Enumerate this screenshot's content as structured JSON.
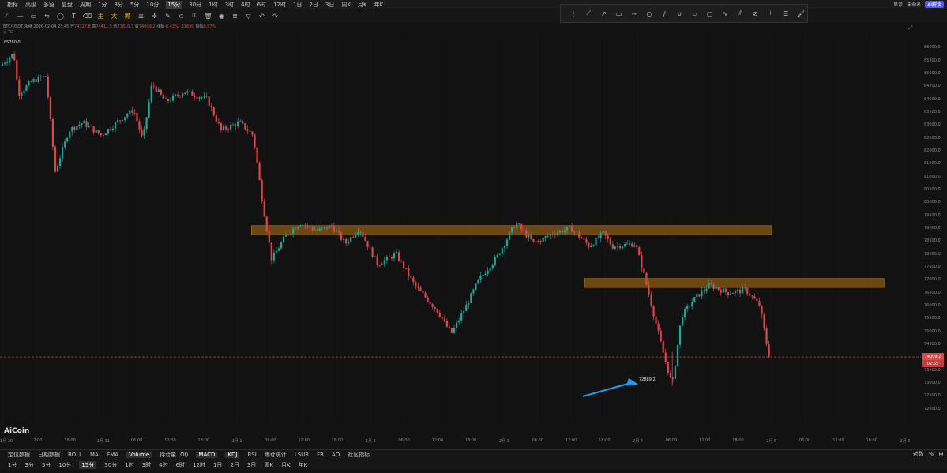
{
  "topbar": {
    "items": [
      {
        "label": "指标",
        "selected": false
      },
      {
        "label": "高级",
        "selected": false
      },
      {
        "label": "多窗",
        "selected": false
      },
      {
        "label": "复盘",
        "selected": false
      },
      {
        "label": "周期",
        "selected": false
      },
      {
        "label": "1分",
        "selected": false
      },
      {
        "label": "3分",
        "selected": false
      },
      {
        "label": "5分",
        "selected": false
      },
      {
        "label": "10分",
        "selected": false
      },
      {
        "label": "15分",
        "selected": true
      },
      {
        "label": "30分",
        "selected": false
      },
      {
        "label": "1时",
        "selected": false
      },
      {
        "label": "3时",
        "selected": false
      },
      {
        "label": "4时",
        "selected": false
      },
      {
        "label": "6时",
        "selected": false
      },
      {
        "label": "12时",
        "selected": false
      },
      {
        "label": "1日",
        "selected": false
      },
      {
        "label": "2日",
        "selected": false
      },
      {
        "label": "3日",
        "selected": false
      },
      {
        "label": "周K",
        "selected": false
      },
      {
        "label": "月K",
        "selected": false
      },
      {
        "label": "年K",
        "selected": false
      }
    ],
    "right_display": "显示",
    "right_layout": "未命名",
    "ai_button": "AI解读"
  },
  "toolbar": {
    "gold_labels": [
      "主",
      "大",
      "筹"
    ]
  },
  "ohlc": {
    "symbol": "BTC/USDT·永续",
    "time": "2026-02-04 23:45",
    "open_label": "开",
    "open": "74327.8",
    "high_label": "高",
    "high": "74411.5",
    "low_label": "低",
    "low": "73810.7",
    "close_label": "收",
    "close": "74009.2",
    "change_label": "涨幅",
    "change": "-0.43%(-318.6)",
    "amp_label": "振幅",
    "amp": "0.87%"
  },
  "sub_label": "TD",
  "hi_label": "85780.0",
  "low_marker": "72889.2",
  "watermark": "AiCoin",
  "price_tag": "74009.2",
  "time_tag": "02:55",
  "colors": {
    "up": "#1aa89a",
    "down": "#e0454a",
    "zone": "#8a5a14",
    "arrow": "#1e9bf0",
    "background": "#121212"
  },
  "chart_data": {
    "type": "candlestick",
    "symbol": "BTC/USDT",
    "interval": "15分",
    "ylim": [
      71500,
      86500
    ],
    "y_ticks": [
      72000,
      72500,
      73000,
      73500,
      74000,
      74500,
      75000,
      75500,
      76000,
      76500,
      77000,
      77500,
      78000,
      78500,
      79000,
      79500,
      80000,
      80500,
      81000,
      81500,
      82000,
      82500,
      83000,
      83500,
      84000,
      84500,
      85000,
      85500,
      86000
    ],
    "x_ticks": [
      "1月 30",
      "12:00",
      "18:00",
      "1月 31",
      "06:00",
      "12:00",
      "18:00",
      "2月 1",
      "06:00",
      "12:00",
      "18:00",
      "2月 2",
      "06:00",
      "12:00",
      "18:00",
      "2月 3",
      "06:00",
      "12:00",
      "18:00",
      "2月 4",
      "06:00",
      "12:00",
      "18:00",
      "2月 5",
      "06:00",
      "12:00",
      "18:00",
      "2月 6"
    ],
    "price_path": [
      [
        0,
        85300
      ],
      [
        0.015,
        85780
      ],
      [
        0.02,
        84200
      ],
      [
        0.035,
        84700
      ],
      [
        0.05,
        84900
      ],
      [
        0.06,
        81200
      ],
      [
        0.075,
        82800
      ],
      [
        0.09,
        83100
      ],
      [
        0.11,
        82600
      ],
      [
        0.13,
        83200
      ],
      [
        0.145,
        83600
      ],
      [
        0.155,
        82400
      ],
      [
        0.165,
        84600
      ],
      [
        0.18,
        83900
      ],
      [
        0.2,
        84300
      ],
      [
        0.225,
        84000
      ],
      [
        0.24,
        82800
      ],
      [
        0.26,
        83100
      ],
      [
        0.275,
        82600
      ],
      [
        0.285,
        80000
      ],
      [
        0.295,
        77800
      ],
      [
        0.31,
        78700
      ],
      [
        0.325,
        79200
      ],
      [
        0.345,
        78900
      ],
      [
        0.36,
        79100
      ],
      [
        0.375,
        78400
      ],
      [
        0.39,
        79000
      ],
      [
        0.41,
        77600
      ],
      [
        0.43,
        78000
      ],
      [
        0.45,
        76800
      ],
      [
        0.475,
        75800
      ],
      [
        0.49,
        74900
      ],
      [
        0.505,
        75900
      ],
      [
        0.52,
        77000
      ],
      [
        0.54,
        77900
      ],
      [
        0.56,
        79200
      ],
      [
        0.58,
        78400
      ],
      [
        0.6,
        78800
      ],
      [
        0.62,
        79000
      ],
      [
        0.64,
        78300
      ],
      [
        0.655,
        78800
      ],
      [
        0.665,
        78300
      ],
      [
        0.69,
        78400
      ],
      [
        0.7,
        77100
      ],
      [
        0.72,
        74200
      ],
      [
        0.73,
        72889.2
      ],
      [
        0.74,
        75600
      ],
      [
        0.755,
        76300
      ],
      [
        0.77,
        76800
      ],
      [
        0.79,
        76500
      ],
      [
        0.81,
        76600
      ],
      [
        0.825,
        76000
      ],
      [
        0.835,
        74009.2
      ]
    ],
    "zones": [
      {
        "label": "resistance-1",
        "top": 79100,
        "bottom": 78750
      },
      {
        "label": "resistance-2",
        "top": 77050,
        "bottom": 76700
      }
    ],
    "high": 85780.0,
    "low": 72889.2,
    "last_price": 74009.2
  },
  "bottom": {
    "indicators": [
      {
        "label": "定位数据",
        "selected": false
      },
      {
        "label": "日期数据",
        "selected": false
      },
      {
        "label": "BOLL",
        "selected": false
      },
      {
        "label": "MA",
        "selected": false
      },
      {
        "label": "EMA",
        "selected": false
      },
      {
        "label": "Volume",
        "selected": true
      },
      {
        "label": "持仓量 (OI)",
        "selected": false
      },
      {
        "label": "MACD",
        "selected": true
      },
      {
        "label": "KDJ",
        "selected": true
      },
      {
        "label": "RSI",
        "selected": false
      },
      {
        "label": "爆仓统计",
        "selected": false
      },
      {
        "label": "LSUR",
        "selected": false
      },
      {
        "label": "FR",
        "selected": false
      },
      {
        "label": "AO",
        "selected": false
      },
      {
        "label": "社区指标",
        "selected": false
      }
    ],
    "right_items": [
      "对数",
      "%",
      "自"
    ],
    "intervals": [
      {
        "label": "1分",
        "selected": false
      },
      {
        "label": "3分",
        "selected": false
      },
      {
        "label": "5分",
        "selected": false
      },
      {
        "label": "10分",
        "selected": false
      },
      {
        "label": "15分",
        "selected": true
      },
      {
        "label": "30分",
        "selected": false
      },
      {
        "label": "1时",
        "selected": false
      },
      {
        "label": "3时",
        "selected": false
      },
      {
        "label": "4时",
        "selected": false
      },
      {
        "label": "6时",
        "selected": false
      },
      {
        "label": "12时",
        "selected": false
      },
      {
        "label": "1日",
        "selected": false
      },
      {
        "label": "2日",
        "selected": false
      },
      {
        "label": "3日",
        "selected": false
      },
      {
        "label": "周K",
        "selected": false
      },
      {
        "label": "月K",
        "selected": false
      },
      {
        "label": "年K",
        "selected": false
      }
    ]
  }
}
